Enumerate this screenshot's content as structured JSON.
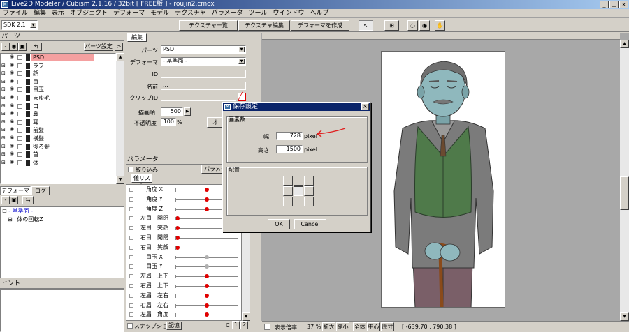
{
  "window": {
    "title": "Live2D Modeler / Cubism 2.1.16 / 32bit  [ FREE版 ] - roujin2.cmox",
    "app_icon": "M"
  },
  "menu": [
    "ファイル",
    "編集",
    "表示",
    "オブジェクト",
    "デフォーマ",
    "モデル",
    "テクスチャ",
    "パラメータ",
    "ツール",
    "ウインドウ",
    "ヘルプ"
  ],
  "toolbar": {
    "sdk": "SDK 2.1",
    "texture_list": "テクスチャ一覧",
    "texture_edit": "テクスチャ編集",
    "create_deformer": "デフォーマを作成"
  },
  "parts_panel": {
    "title": "パーツ",
    "settings": "パーツ設定",
    "items": [
      {
        "name": "PSD",
        "selected": true
      },
      {
        "name": "ラフ"
      },
      {
        "name": "顔"
      },
      {
        "name": "目"
      },
      {
        "name": "目玉"
      },
      {
        "name": "まゆ毛"
      },
      {
        "name": "口"
      },
      {
        "name": "鼻"
      },
      {
        "name": "耳"
      },
      {
        "name": "前髪"
      },
      {
        "name": "横髪"
      },
      {
        "name": "後ろ髪"
      },
      {
        "name": "首"
      },
      {
        "name": "体"
      }
    ]
  },
  "deformer_panel": {
    "tab1": "デフォーマ",
    "tab2": "ログ",
    "root": "- 基準面 -",
    "child": "体の回転Z"
  },
  "hint_panel": {
    "title": "ヒント"
  },
  "edit_panel": {
    "title": "編集",
    "parts_label": "パーツ",
    "parts_value": "PSD",
    "deformer_label": "デフォーマ",
    "deformer_value": "- 基準面 -",
    "id_label": "ID",
    "id_value": "...",
    "name_label": "名前",
    "name_value": "...",
    "clip_label": "クリップID",
    "clip_value": "...",
    "draw_order_label": "描画順",
    "draw_order_value": "500",
    "opacity_label": "不透明度",
    "opacity_value": "100",
    "opacity_unit": "%",
    "option_button": "オ"
  },
  "param_panel": {
    "title": "パラメータ",
    "filter_label": "絞り込み",
    "param_button": "パラメー",
    "value_list_tab": "値リスト",
    "snapshot_label": "スナップショット",
    "memory_button": "記憶",
    "c_label": "C",
    "page1": "1",
    "page2": "2",
    "params": [
      {
        "name": "角度 X",
        "pos": 0.5
      },
      {
        "name": "角度 Y",
        "pos": 0.5
      },
      {
        "name": "角度 Z",
        "pos": 0.5
      },
      {
        "name": "左目　開閉",
        "pos": 0.0
      },
      {
        "name": "左目　笑顔",
        "pos": 0.0
      },
      {
        "name": "右目　開閉",
        "pos": 0.0
      },
      {
        "name": "右目　笑顔",
        "pos": 0.0
      },
      {
        "name": "目玉 X",
        "pos": 0.5
      },
      {
        "name": "目玉 Y",
        "pos": 0.5
      },
      {
        "name": "左眉　上下",
        "pos": 0.5
      },
      {
        "name": "右眉　上下",
        "pos": 0.5
      },
      {
        "name": "左眉　左右",
        "pos": 0.5
      },
      {
        "name": "右眉　左右",
        "pos": 0.5
      },
      {
        "name": "左眉　角度",
        "pos": 0.5
      }
    ]
  },
  "dialog": {
    "title": "保存設定",
    "size_group": "画素数",
    "width_label": "幅",
    "width_value": "728",
    "width_unit": "pixel",
    "height_label": "高さ",
    "height_value": "1500",
    "height_unit": "pixel",
    "position_group": "配置",
    "ok": "OK",
    "cancel": "Cancel"
  },
  "statusbar": {
    "zoom_label": "表示倍率",
    "zoom_value": "37 %",
    "zoom_in": "拡大",
    "zoom_out": "縮小",
    "fit": "全体",
    "center": "中心",
    "actual": "原寸",
    "coords": "[ -639.70 ,  790.38 ]"
  },
  "colors": {
    "selected_part": "#f4a0a0",
    "knob_red": "#e00000",
    "knob_gray": "#b0b0b0",
    "annotation_arrow": "#e02020",
    "canvas_bg": "#a8a8a8"
  }
}
